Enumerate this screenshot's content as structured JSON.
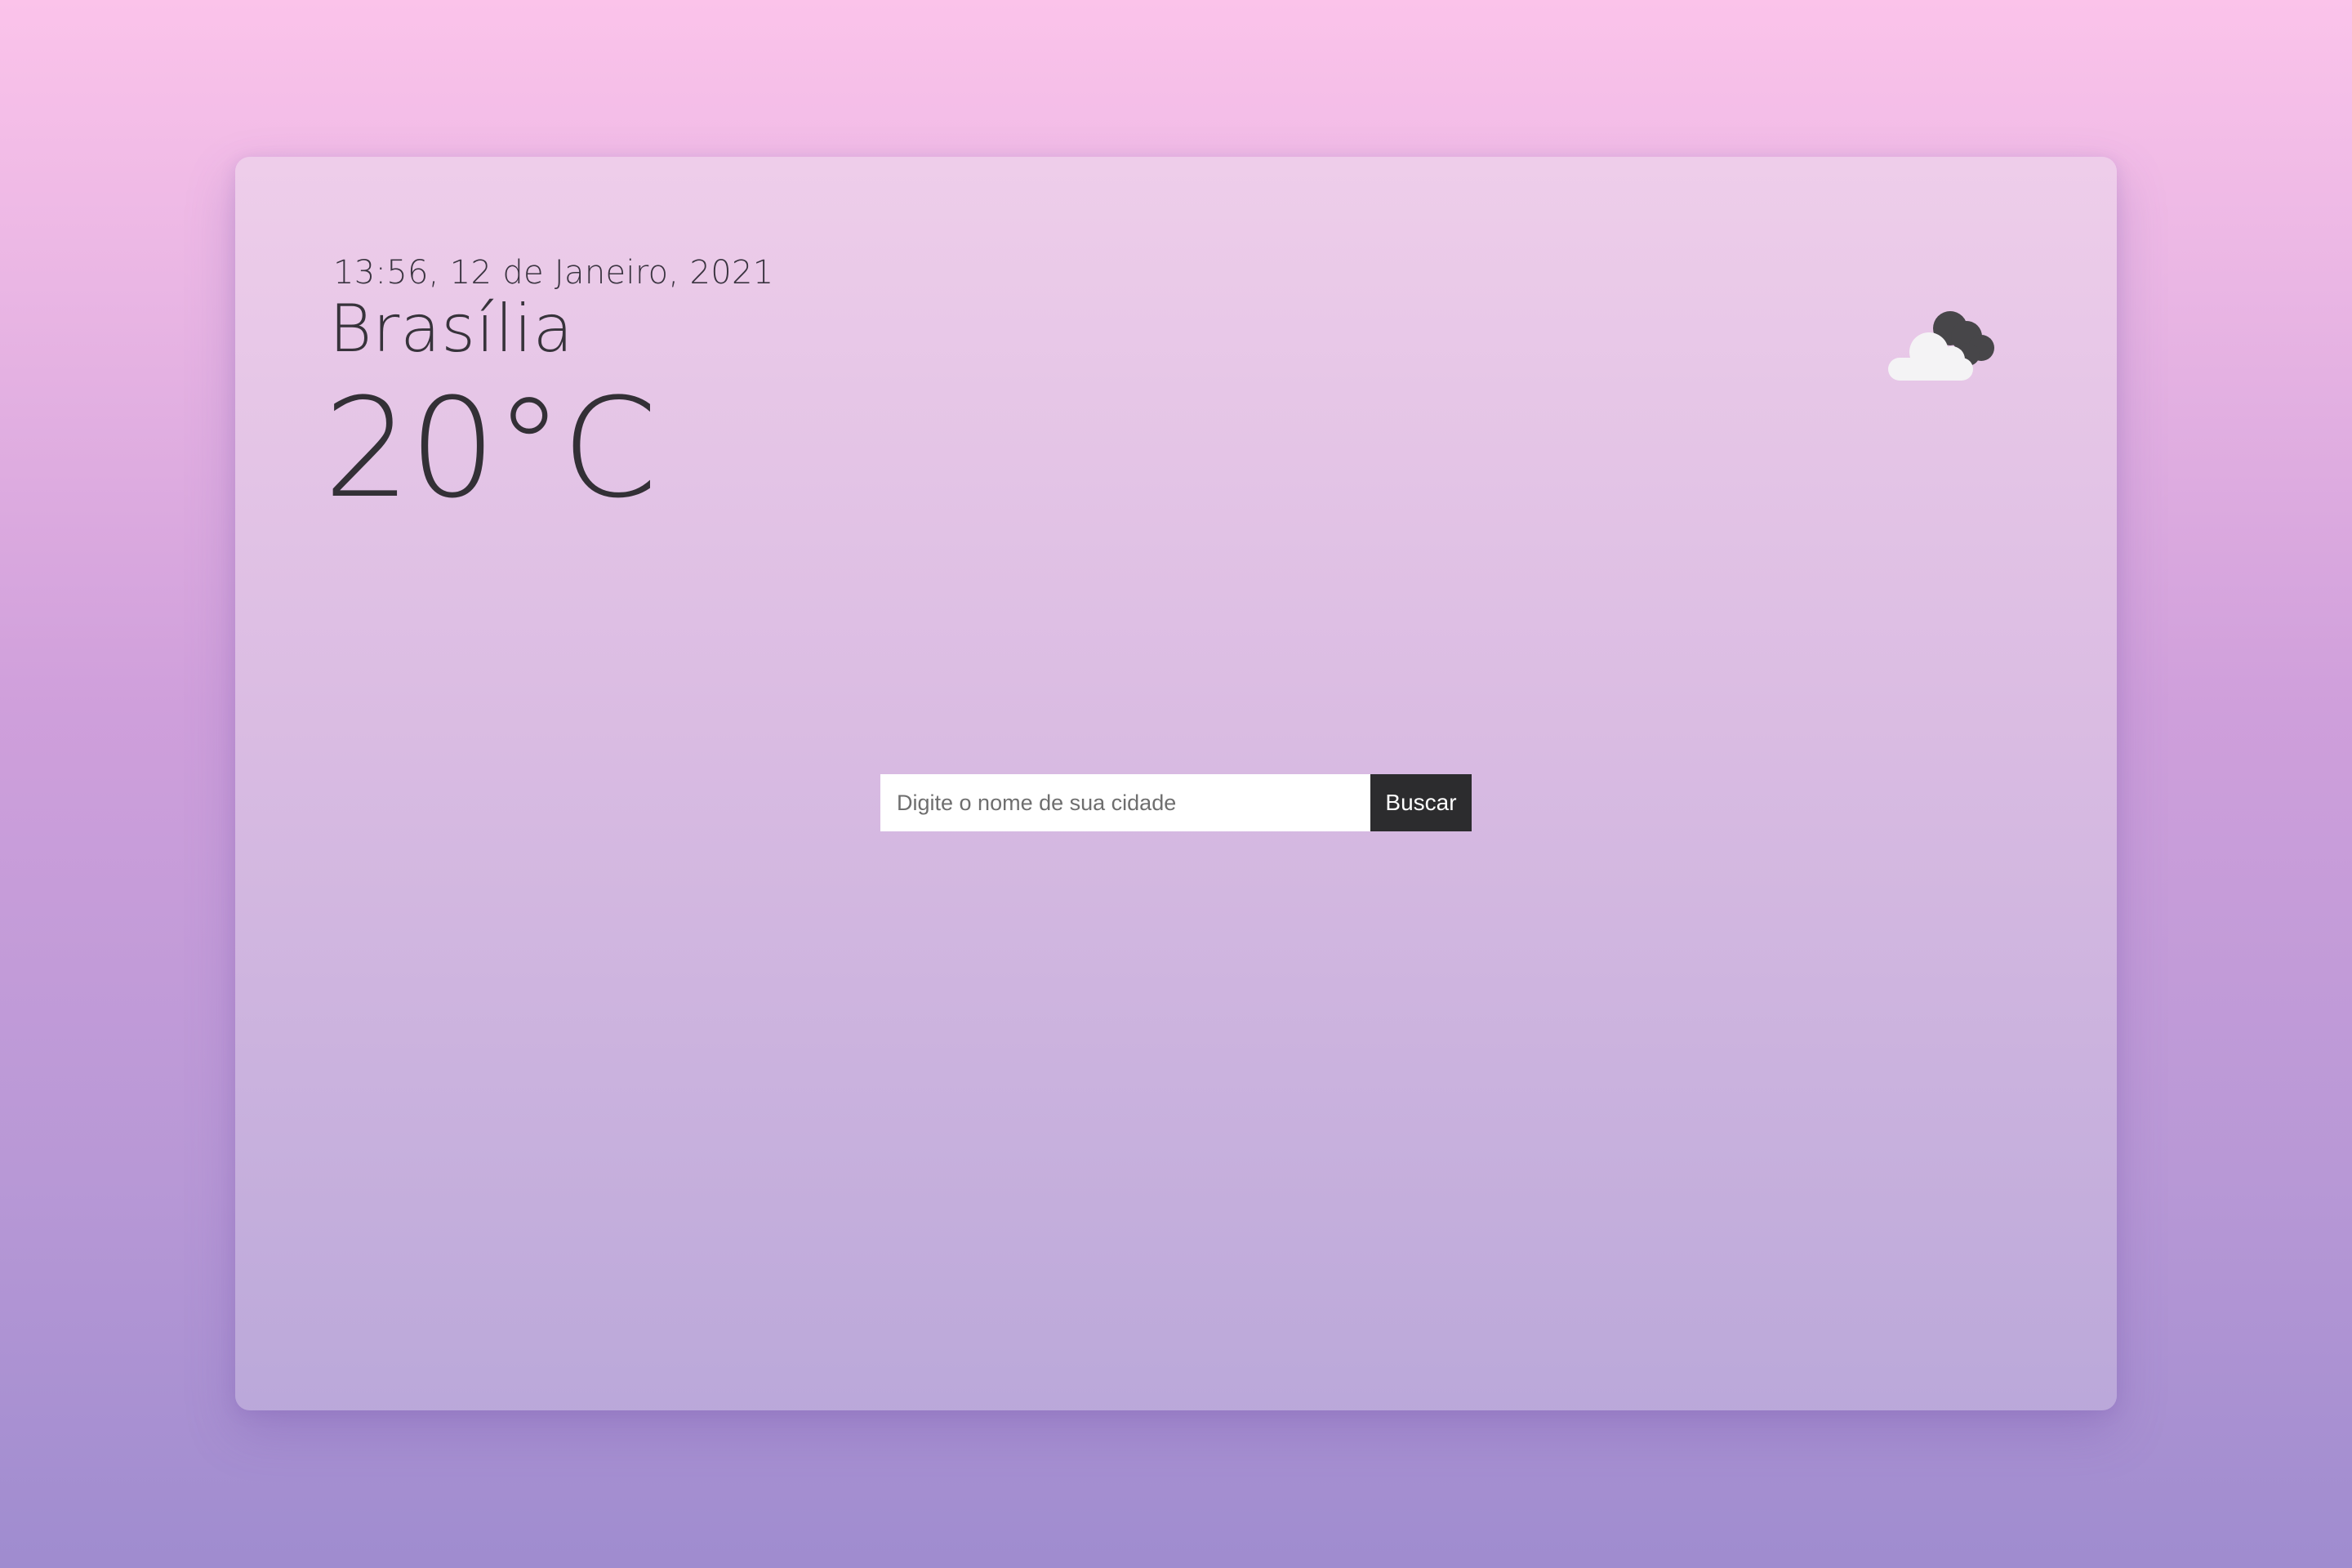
{
  "weather": {
    "datetime": "13:56, 12 de Janeiro, 2021",
    "city": "Brasília",
    "temperature": "20°C",
    "icon": "cloud-icon"
  },
  "search": {
    "placeholder": "Digite o nome de sua cidade",
    "value": "",
    "button_label": "Buscar"
  },
  "colors": {
    "background_top": "#fbc3ea",
    "background_bottom": "#9f8ccf",
    "text": "#333036",
    "button": "#2c2c2e"
  }
}
